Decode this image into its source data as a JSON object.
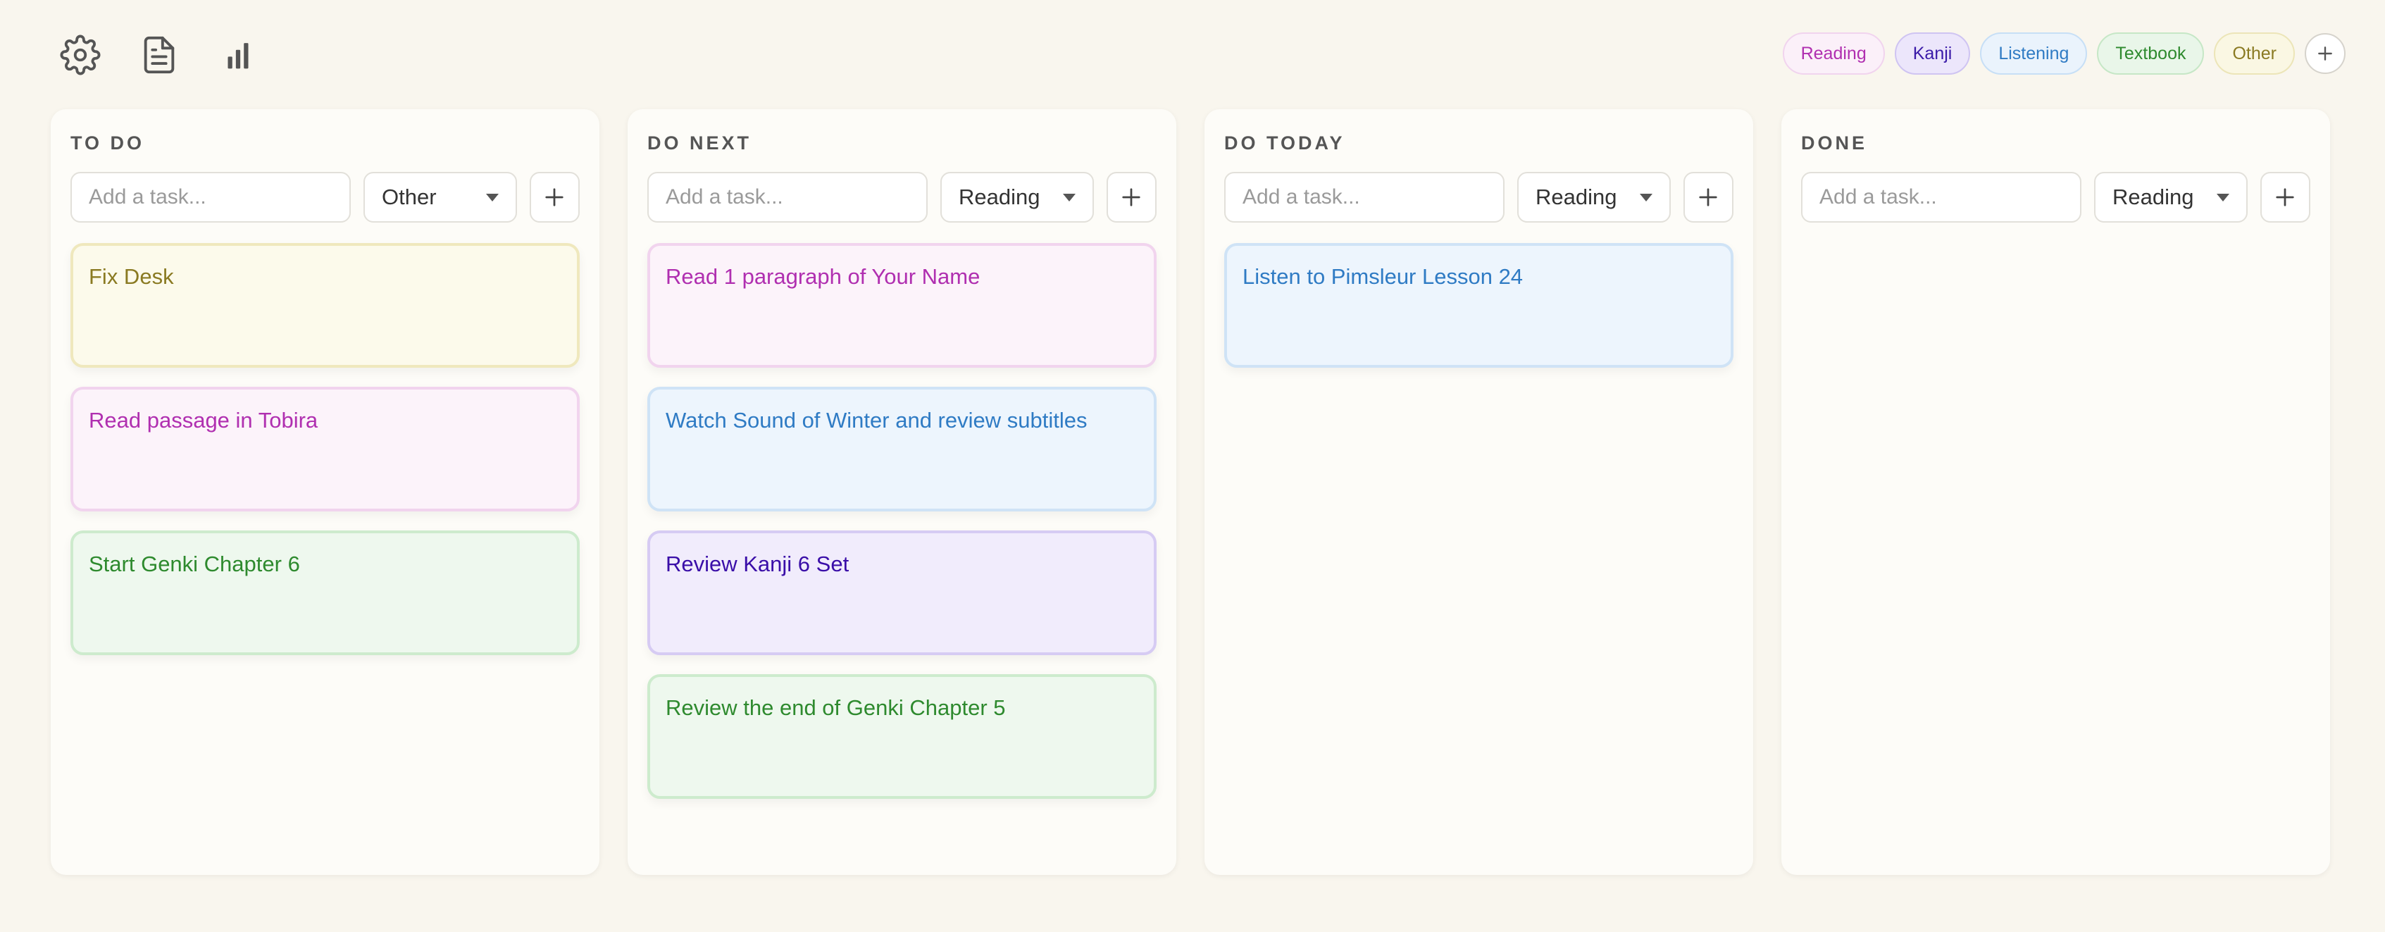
{
  "toolbar": {
    "icons": [
      {
        "name": "settings-icon"
      },
      {
        "name": "document-icon"
      },
      {
        "name": "bar-chart-icon"
      }
    ]
  },
  "tags": [
    {
      "label": "Reading",
      "text_color": "#b02fb0",
      "bg": "#fbf0f9",
      "border": "#f1d4ee"
    },
    {
      "label": "Kanji",
      "text_color": "#3a1aa8",
      "bg": "#ece6fb",
      "border": "#cfc4f2"
    },
    {
      "label": "Listening",
      "text_color": "#2f7bc4",
      "bg": "#eaf3fc",
      "border": "#c7dff6"
    },
    {
      "label": "Textbook",
      "text_color": "#2e8a2e",
      "bg": "#e9f6e9",
      "border": "#c6e7c6"
    },
    {
      "label": "Other",
      "text_color": "#8a7a22",
      "bg": "#faf7e3",
      "border": "#ece5b8"
    }
  ],
  "columns": [
    {
      "title": "TO DO",
      "input_placeholder": "Add a task...",
      "selected_category": "Other",
      "cards": [
        {
          "text": "Fix Desk",
          "category": "Other"
        },
        {
          "text": "Read passage in Tobira",
          "category": "Reading"
        },
        {
          "text": "Start Genki Chapter 6",
          "category": "Textbook"
        }
      ]
    },
    {
      "title": "DO NEXT",
      "input_placeholder": "Add a task...",
      "selected_category": "Reading",
      "cards": [
        {
          "text": "Read 1 paragraph of Your Name",
          "category": "Reading"
        },
        {
          "text": "Watch Sound of Winter and review subtitles",
          "category": "Listening"
        },
        {
          "text": "Review Kanji 6 Set",
          "category": "Kanji"
        },
        {
          "text": "Review the end of Genki Chapter 5",
          "category": "Textbook"
        }
      ]
    },
    {
      "title": "DO TODAY",
      "input_placeholder": "Add a task...",
      "selected_category": "Reading",
      "cards": [
        {
          "text": "Listen to Pimsleur Lesson 24",
          "category": "Listening"
        }
      ]
    },
    {
      "title": "DONE",
      "input_placeholder": "Add a task...",
      "selected_category": "Reading",
      "cards": []
    }
  ],
  "category_styles": {
    "Reading": {
      "text": "#b02fb0",
      "bg": "#fcf3fa",
      "border": "#f1d4ee"
    },
    "Kanji": {
      "text": "#3a0ea8",
      "bg": "#f1ecfc",
      "border": "#d6cbf3"
    },
    "Listening": {
      "text": "#2f7bc4",
      "bg": "#edf5fd",
      "border": "#cfe3f6"
    },
    "Textbook": {
      "text": "#2e8a2e",
      "bg": "#eef8ee",
      "border": "#cdebcd"
    },
    "Other": {
      "text": "#8a7a22",
      "bg": "#fcfaeb",
      "border": "#efe8bd"
    }
  }
}
